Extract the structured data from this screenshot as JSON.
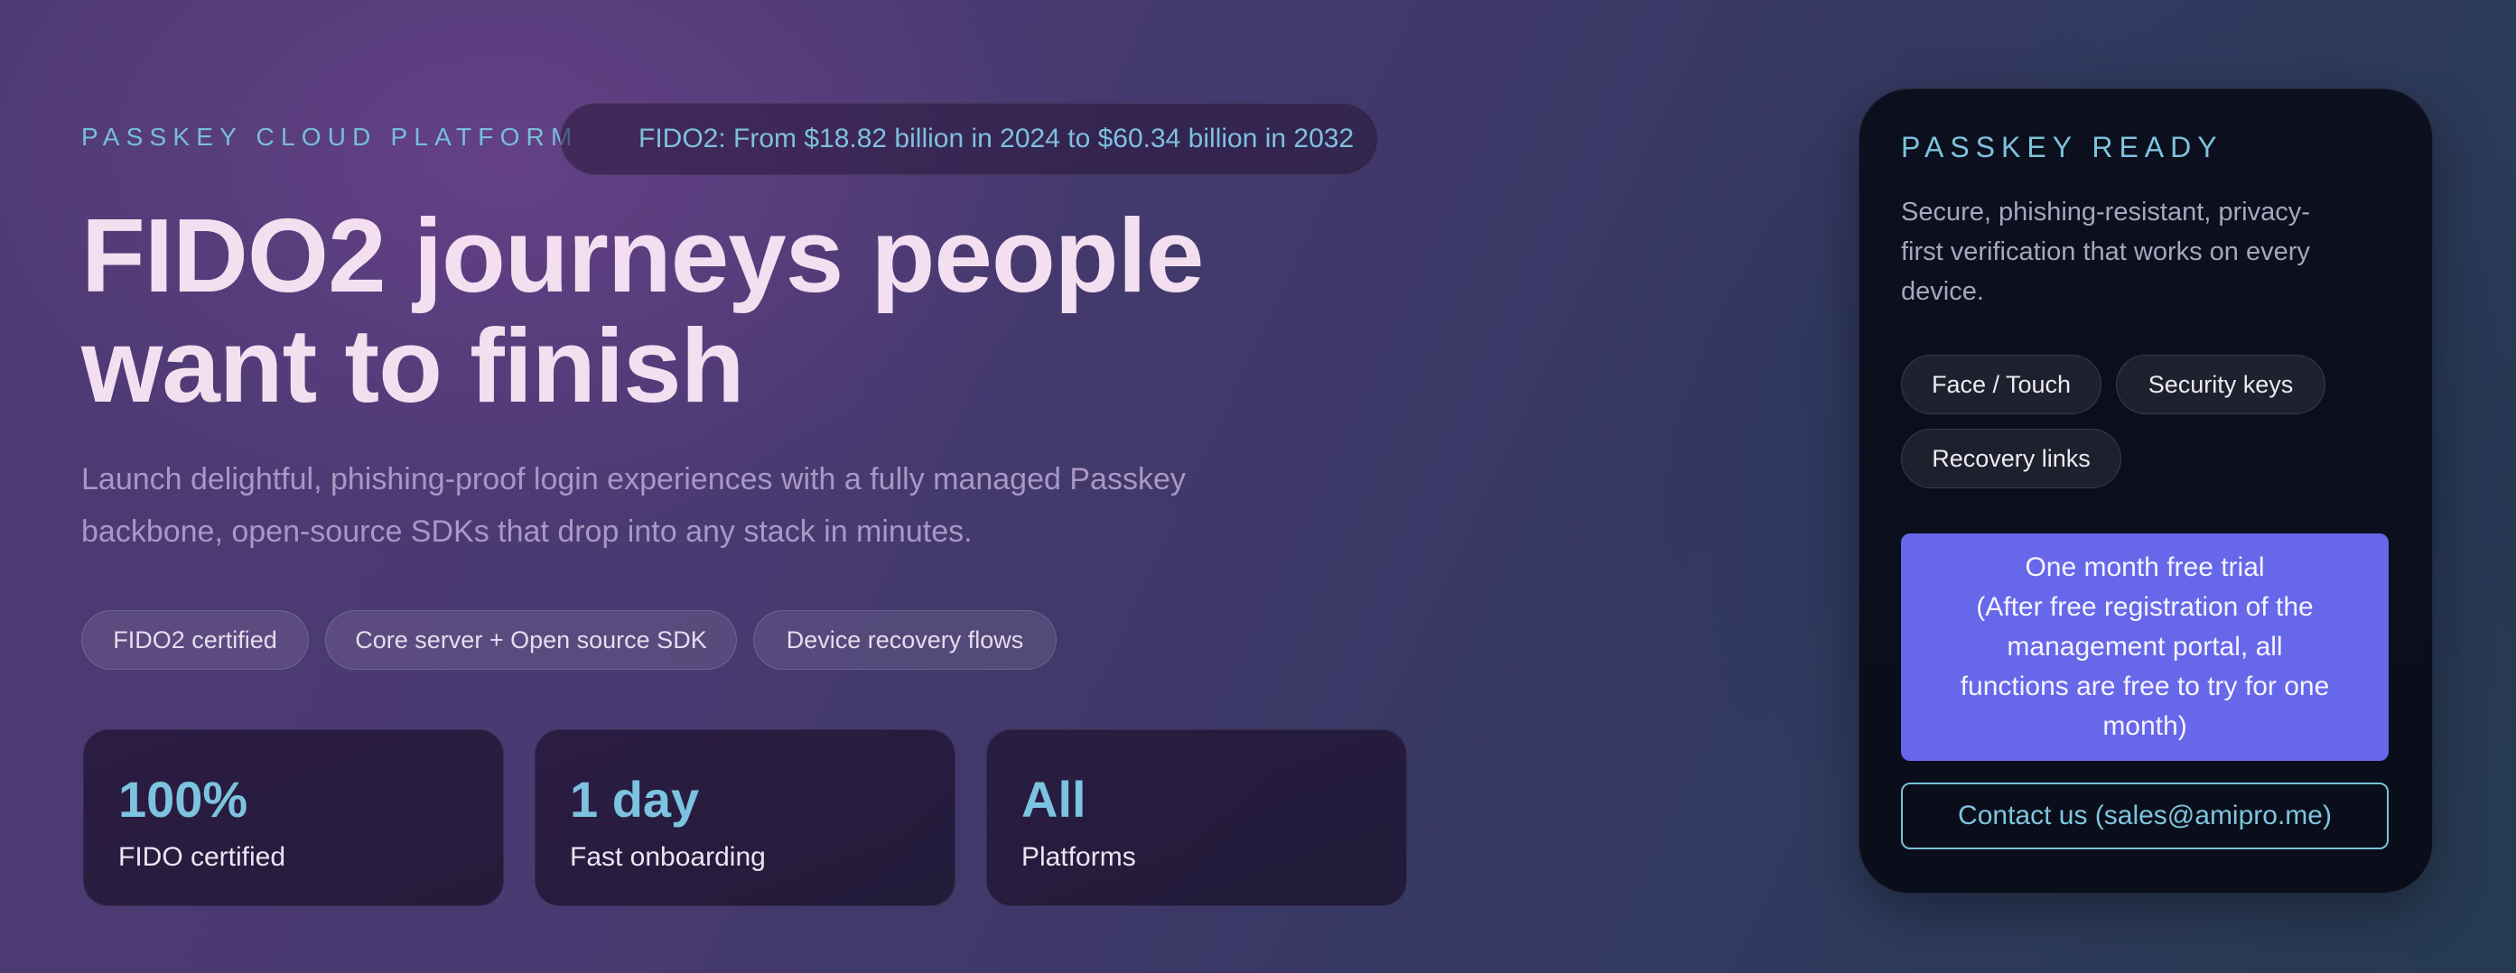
{
  "hero": {
    "eyebrow": "PASSKEY CLOUD PLATFORM",
    "market_stat": "FIDO2: From $18.82 billion in 2024 to $60.34 billion in 2032",
    "headline_line1": "FIDO2 journeys people",
    "headline_line2": "want to finish",
    "subtext_line1": "Launch delightful, phishing-proof login experiences with a fully managed Passkey",
    "subtext_line2": "backbone, open-source SDKs that drop into any stack in minutes.",
    "chips": [
      "FIDO2 certified",
      "Core server + Open source SDK",
      "Device recovery flows"
    ],
    "stats": [
      {
        "value": "100%",
        "label": "FIDO certified"
      },
      {
        "value": "1 day",
        "label": "Fast onboarding"
      },
      {
        "value": "All",
        "label": "Platforms"
      }
    ]
  },
  "panel": {
    "eyebrow": "PASSKEY READY",
    "desc_line1": "Secure, phishing-resistant, privacy-",
    "desc_line2": "first verification that works on every",
    "desc_line3": "device.",
    "chips": [
      "Face / Touch",
      "Security keys",
      "Recovery links"
    ],
    "trial_lines": [
      "One month free trial",
      "(After free registration of the",
      "management portal, all",
      "functions are free to try for one",
      "month)"
    ],
    "contact_label": "Contact us (sales@amipro.me)"
  },
  "colors": {
    "accent_cyan": "#7cc3e0",
    "button_primary": "#6767ea",
    "headline": "#f3dff0",
    "panel_bg": "#0b0f1c"
  }
}
